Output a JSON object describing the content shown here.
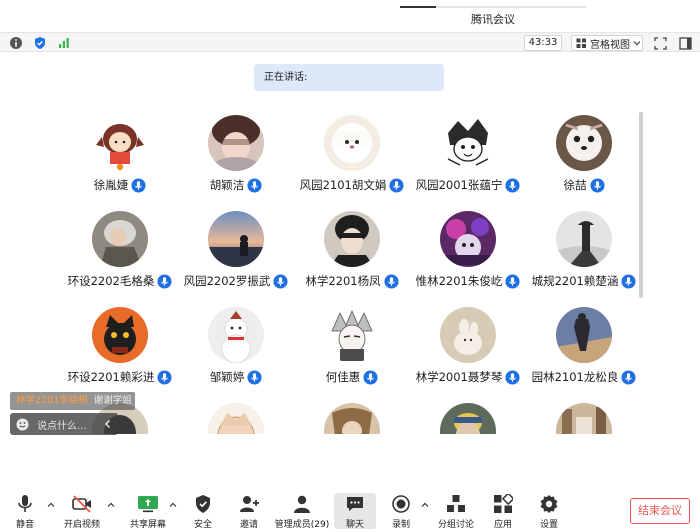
{
  "window": {
    "title": "腾讯会议"
  },
  "topbar": {
    "timer": "43:33",
    "view_label": "宫格视图"
  },
  "speaking": {
    "label": "正在讲话:"
  },
  "participants": [
    {
      "name": "徐胤婕"
    },
    {
      "name": "胡颖洁"
    },
    {
      "name": "风园2101胡文娟"
    },
    {
      "name": "风园2001张蕴宁"
    },
    {
      "name": "徐喆"
    },
    {
      "name": "环设2202毛格桑"
    },
    {
      "name": "风园2202罗振武"
    },
    {
      "name": "林学2201杨凤"
    },
    {
      "name": "惟林2201朱俊屹"
    },
    {
      "name": "城规2201赖楚涵"
    },
    {
      "name": "环设2201赖彩进"
    },
    {
      "name": "邹颖婷"
    },
    {
      "name": "何佳惠"
    },
    {
      "name": "林学2001聂梦琴"
    },
    {
      "name": "园林2101龙松良"
    }
  ],
  "chat": {
    "notif_sender": "林学2201李晓桐",
    "notif_message": "谢谢学姐",
    "input_placeholder": "说点什么..."
  },
  "bottombar": {
    "mute": "静音",
    "video": "开启视频",
    "share": "共享屏幕",
    "security": "安全",
    "invite": "邀请",
    "members": "管理成员(29)",
    "chat": "聊天",
    "record": "录制",
    "breakout": "分组讨论",
    "apps": "应用",
    "settings": "设置",
    "end": "结束会议"
  },
  "colors": {
    "accent": "#1f6fe5",
    "end_red": "#e8574f",
    "speaking_bg": "#dde8fb"
  }
}
